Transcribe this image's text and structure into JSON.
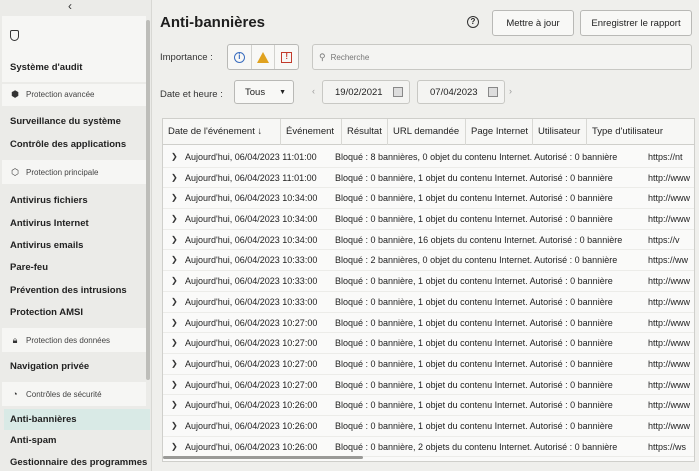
{
  "sidebar": {
    "collapse_glyph": "‹",
    "items": {
      "audit": "Système d'audit",
      "advanced": "Protection avancée",
      "surveillance": "Surveillance du système",
      "app_control": "Contrôle des applications",
      "main_protection": "Protection principale",
      "antivirus_files": "Antivirus fichiers",
      "antivirus_internet": "Antivirus Internet",
      "antivirus_email": "Antivirus emails",
      "firewall": "Pare-feu",
      "intrusion": "Prévention des intrusions",
      "amsi": "Protection AMSI",
      "data_protection": "Protection des données",
      "private_browsing": "Navigation privée",
      "security_controls": "Contrôles de sécurité",
      "antibanner": "Anti-bannières",
      "antispam": "Anti-spam",
      "program_manager": "Gestionnaire des programmes"
    },
    "selected": "antibanner"
  },
  "header": {
    "title": "Anti-bannières",
    "help_glyph": "?",
    "start_label": "Mettre à jour",
    "save_label": "Enregistrer le rapport"
  },
  "filters": {
    "importance_label": "Importance :",
    "search_placeholder": "Recherche",
    "date_label": "Date et heure :",
    "period_value": "Tous",
    "date_from": "19/02/2021",
    "date_to": "07/04/2023"
  },
  "table": {
    "columns": [
      "Date de l'événement ↓",
      "Événement",
      "Résultat",
      "URL demandée",
      "Page Internet",
      "Utilisateur",
      "Type d'utilisateur"
    ],
    "rows": [
      {
        "date": "Aujourd'hui, 06/04/2023 11:01:00",
        "status": "Bloqué : 8 bannières, 0 objet du contenu Internet. Autorisé : 0 bannière",
        "url": "https://nt"
      },
      {
        "date": "Aujourd'hui, 06/04/2023 11:01:00",
        "status": "Bloqué : 0 bannière, 1 objet du contenu Internet. Autorisé : 0 bannière",
        "url": "http://www"
      },
      {
        "date": "Aujourd'hui, 06/04/2023 10:34:00",
        "status": "Bloqué : 0 bannière, 1 objet du contenu Internet. Autorisé : 0 bannière",
        "url": "http://www"
      },
      {
        "date": "Aujourd'hui, 06/04/2023 10:34:00",
        "status": "Bloqué : 0 bannière, 1 objet du contenu Internet. Autorisé : 0 bannière",
        "url": "http://www"
      },
      {
        "date": "Aujourd'hui, 06/04/2023 10:34:00",
        "status": "Bloqué : 0 bannière, 16 objets du contenu Internet. Autorisé : 0 bannière",
        "url": "https://v"
      },
      {
        "date": "Aujourd'hui, 06/04/2023 10:33:00",
        "status": "Bloqué : 2 bannières, 0 objet du contenu Internet. Autorisé : 0 bannière",
        "url": "https://ww"
      },
      {
        "date": "Aujourd'hui, 06/04/2023 10:33:00",
        "status": "Bloqué : 0 bannière, 1 objet du contenu Internet. Autorisé : 0 bannière",
        "url": "http://www"
      },
      {
        "date": "Aujourd'hui, 06/04/2023 10:33:00",
        "status": "Bloqué : 0 bannière, 1 objet du contenu Internet. Autorisé : 0 bannière",
        "url": "http://www"
      },
      {
        "date": "Aujourd'hui, 06/04/2023 10:27:00",
        "status": "Bloqué : 0 bannière, 1 objet du contenu Internet. Autorisé : 0 bannière",
        "url": "http://www"
      },
      {
        "date": "Aujourd'hui, 06/04/2023 10:27:00",
        "status": "Bloqué : 0 bannière, 1 objet du contenu Internet. Autorisé : 0 bannière",
        "url": "http://www"
      },
      {
        "date": "Aujourd'hui, 06/04/2023 10:27:00",
        "status": "Bloqué : 0 bannière, 1 objet du contenu Internet. Autorisé : 0 bannière",
        "url": "http://www"
      },
      {
        "date": "Aujourd'hui, 06/04/2023 10:27:00",
        "status": "Bloqué : 0 bannière, 1 objet du contenu Internet. Autorisé : 0 bannière",
        "url": "http://www"
      },
      {
        "date": "Aujourd'hui, 06/04/2023 10:26:00",
        "status": "Bloqué : 0 bannière, 1 objet du contenu Internet. Autorisé : 0 bannière",
        "url": "http://www"
      },
      {
        "date": "Aujourd'hui, 06/04/2023 10:26:00",
        "status": "Bloqué : 0 bannière, 1 objet du contenu Internet. Autorisé : 0 bannière",
        "url": "http://www"
      },
      {
        "date": "Aujourd'hui, 06/04/2023 10:26:00",
        "status": "Bloqué : 0 bannière, 2 objets du contenu Internet. Autorisé : 0 bannière",
        "url": "https://ws"
      }
    ]
  }
}
